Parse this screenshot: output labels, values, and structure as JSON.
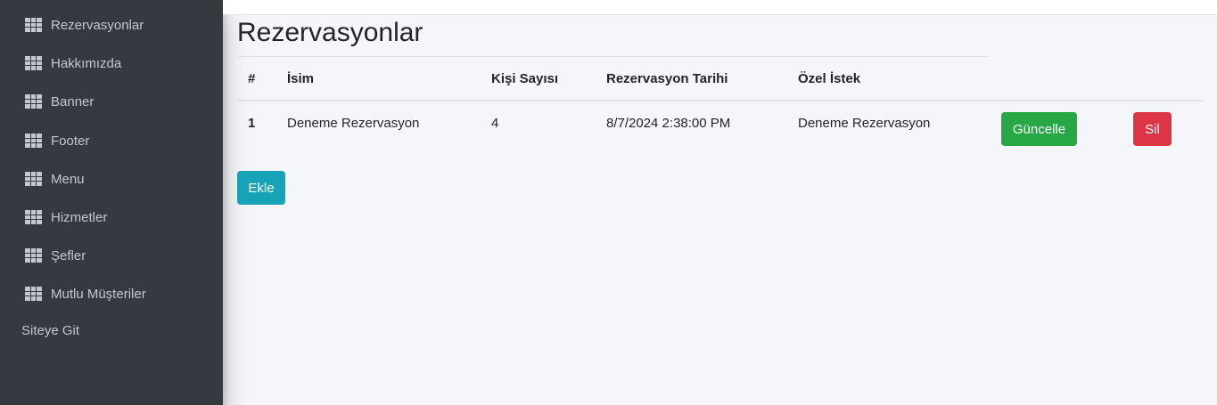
{
  "sidebar": {
    "items": [
      {
        "label": "Rezervasyonlar",
        "icon": "grid-icon"
      },
      {
        "label": "Hakkımızda",
        "icon": "grid-icon"
      },
      {
        "label": "Banner",
        "icon": "grid-icon"
      },
      {
        "label": "Footer",
        "icon": "grid-icon"
      },
      {
        "label": "Menu",
        "icon": "grid-icon"
      },
      {
        "label": "Hizmetler",
        "icon": "grid-icon"
      },
      {
        "label": "Şefler",
        "icon": "grid-icon"
      },
      {
        "label": "Mutlu Müşteriler",
        "icon": "grid-icon"
      }
    ],
    "site_link": "Siteye Git"
  },
  "main": {
    "title": "Rezervasyonlar",
    "table": {
      "headers": [
        "#",
        "İsim",
        "Kişi Sayısı",
        "Rezervasyon Tarihi",
        "Özel İstek"
      ],
      "rows": [
        {
          "id": "1",
          "name": "Deneme Rezervasyon",
          "people": "4",
          "date": "8/7/2024 2:38:00 PM",
          "request": "Deneme Rezervasyon",
          "update_label": "Güncelle",
          "delete_label": "Sil"
        }
      ]
    },
    "add_label": "Ekle"
  },
  "colors": {
    "sidebar_bg": "#343a40",
    "success": "#28a745",
    "danger": "#dc3545",
    "info": "#17a2b8"
  }
}
